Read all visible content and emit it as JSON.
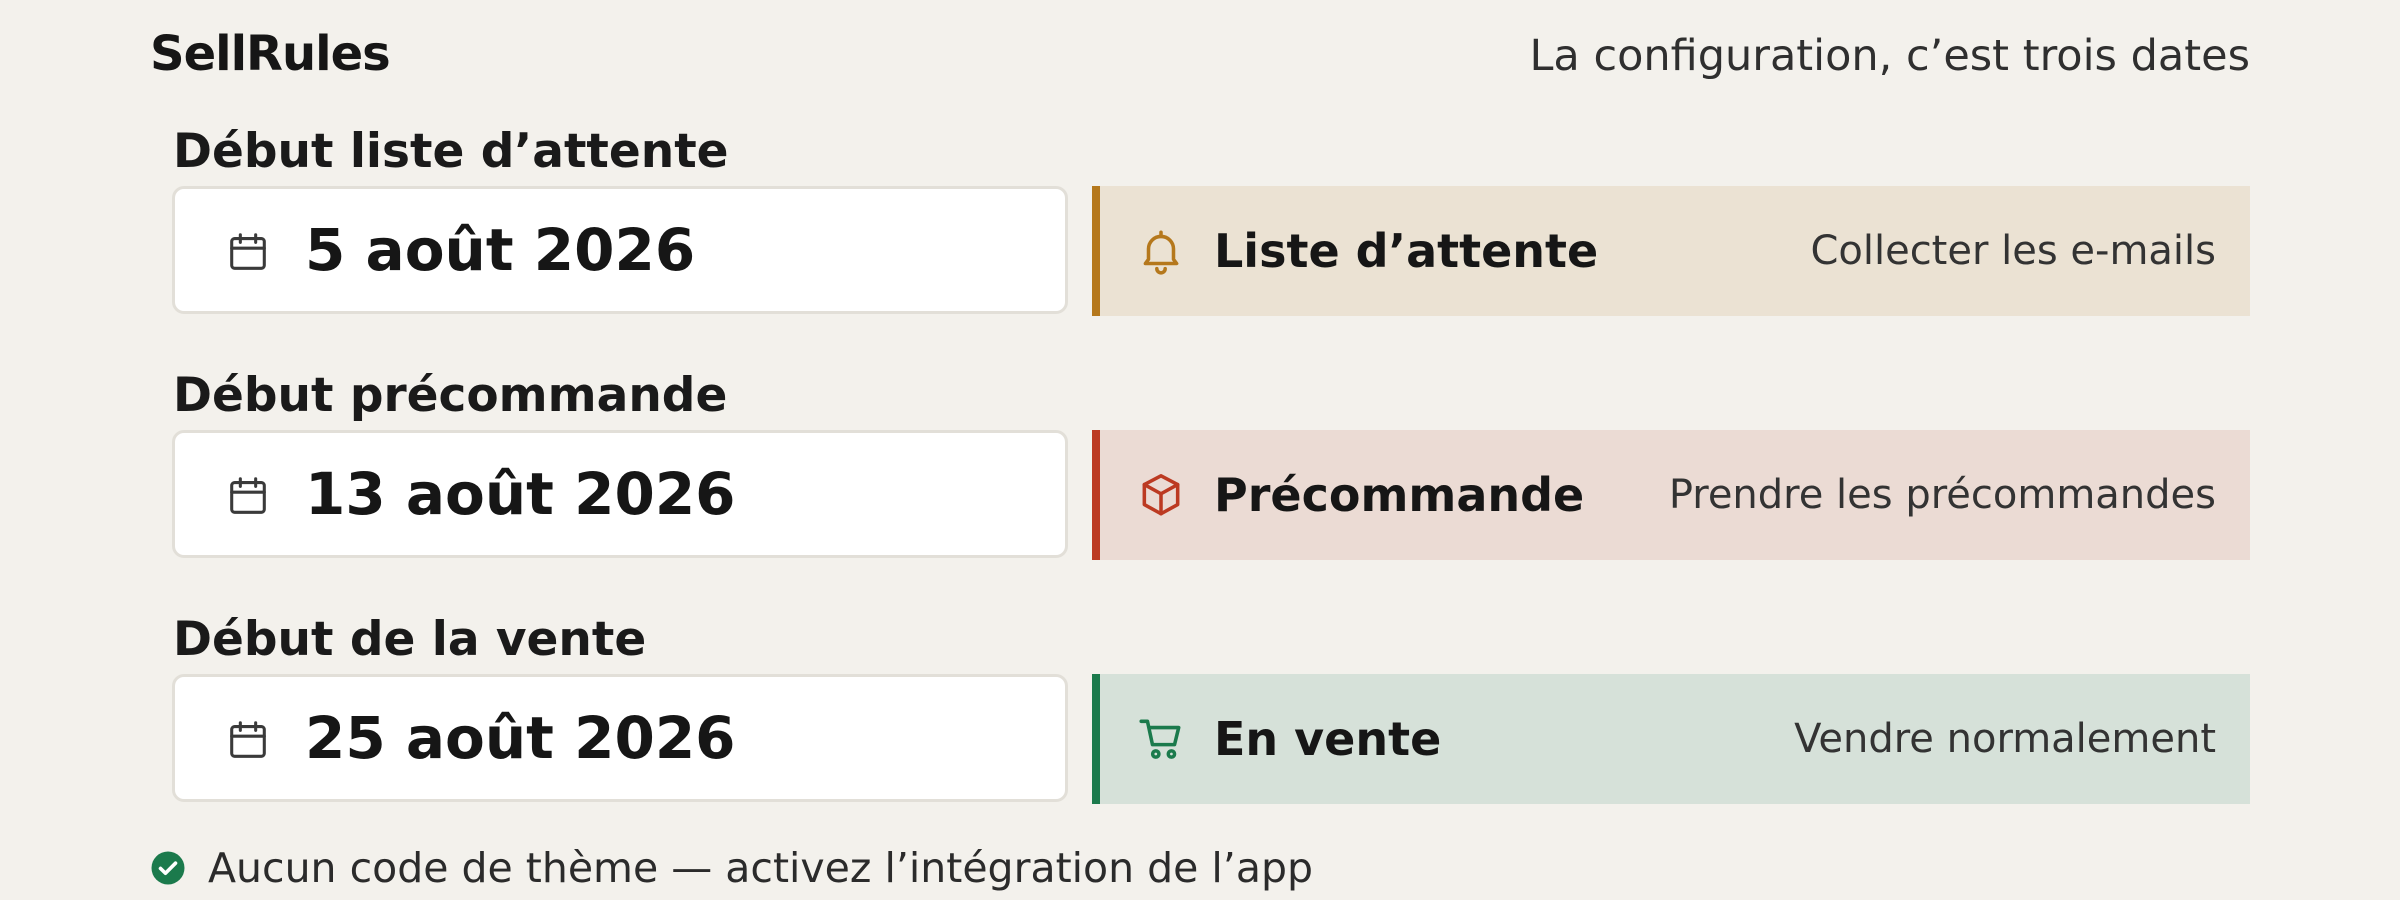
{
  "app": {
    "brand": "SellRules",
    "tagline": "La configuration, c’est trois dates"
  },
  "rows": [
    {
      "label": "Début liste d’attente",
      "date": "5 août 2026",
      "stage": {
        "title": "Liste d’attente",
        "description": "Collecter les e-mails",
        "icon": "bell-icon",
        "accent": "#b5781c",
        "background": "#ebe2d3"
      }
    },
    {
      "label": "Début précommande",
      "date": "13 août 2026",
      "stage": {
        "title": "Précommande",
        "description": "Prendre les précommandes",
        "icon": "package-icon",
        "accent": "#bc3a22",
        "background": "#ebdbd4"
      }
    },
    {
      "label": "Début de la vente",
      "date": "25 août 2026",
      "stage": {
        "title": "En vente",
        "description": "Vendre normalement",
        "icon": "cart-icon",
        "accent": "#1b7a4c",
        "background": "#d6e1d9"
      }
    }
  ],
  "footer": {
    "status_icon": "check-circle-icon",
    "status_color": "#1b7a4c",
    "text": "Aucun code de thème — activez l’intégration de l’app"
  }
}
